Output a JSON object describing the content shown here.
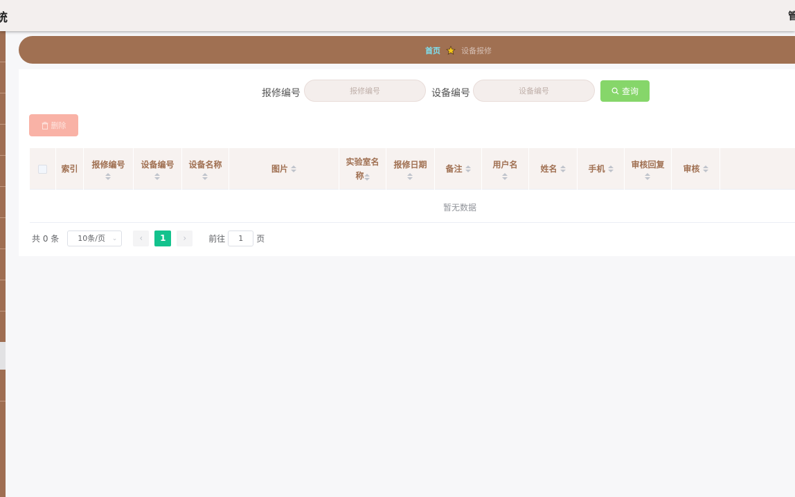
{
  "app": {
    "title_fragment": "统",
    "right_glyph": "管"
  },
  "breadcrumb": {
    "home": "首页",
    "current": "设备报修"
  },
  "search": {
    "repair_no_label": "报修编号",
    "repair_no_placeholder": "报修编号",
    "device_no_label": "设备编号",
    "device_no_placeholder": "设备编号",
    "query_label": "查询"
  },
  "toolbar": {
    "delete_label": "删除"
  },
  "table": {
    "columns": [
      {
        "key": "index",
        "label": "索引"
      },
      {
        "key": "repair_no",
        "label": "报修编号"
      },
      {
        "key": "device_no",
        "label": "设备编号"
      },
      {
        "key": "device_name",
        "label": "设备名称"
      },
      {
        "key": "image",
        "label": "图片"
      },
      {
        "key": "lab_name_1",
        "label": "实验室名"
      },
      {
        "key": "lab_name_2",
        "label": "称"
      },
      {
        "key": "repair_date",
        "label": "报修日期"
      },
      {
        "key": "remark",
        "label": "备注"
      },
      {
        "key": "username",
        "label": "用户名"
      },
      {
        "key": "name",
        "label": "姓名"
      },
      {
        "key": "phone",
        "label": "手机"
      },
      {
        "key": "review_reply",
        "label": "审核回复"
      },
      {
        "key": "review",
        "label": "审核"
      }
    ],
    "rows": [],
    "empty_text": "暂无数据"
  },
  "pagination": {
    "total_text": "共 0 条",
    "page_size": "10条/页",
    "current_page": "1",
    "goto_label": "前往",
    "goto_value": "1",
    "page_suffix": "页"
  },
  "colors": {
    "brand": "#a07052",
    "query_button": "#86d66a",
    "delete_button": "#f9b2a6",
    "active_page": "#13c28d"
  }
}
